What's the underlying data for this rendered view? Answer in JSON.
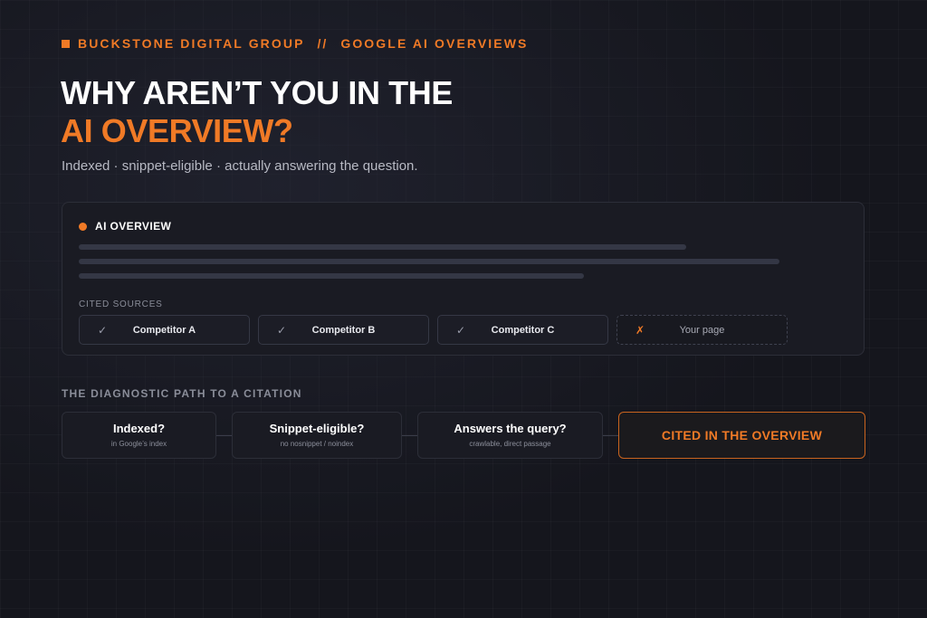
{
  "eyebrow": {
    "brand": "BUCKSTONE DIGITAL GROUP",
    "separator": "//",
    "topic": "GOOGLE AI OVERVIEWS"
  },
  "headline": {
    "line1": "WHY AREN’T YOU IN THE",
    "line2": "AI OVERVIEW?"
  },
  "subtitle": "Indexed · snippet-eligible · actually answering the question.",
  "overview": {
    "label": "AI OVERVIEW",
    "cited_label": "CITED SOURCES",
    "sources": [
      {
        "mark": "✓",
        "name": "Competitor A",
        "cited": true
      },
      {
        "mark": "✓",
        "name": "Competitor B",
        "cited": true
      },
      {
        "mark": "✓",
        "name": "Competitor C",
        "cited": true
      },
      {
        "mark": "✗",
        "name": "Your page",
        "cited": false
      }
    ]
  },
  "diagnostic": {
    "label": "THE DIAGNOSTIC PATH TO A CITATION",
    "steps": [
      {
        "title": "Indexed?",
        "sub": "in Google’s index"
      },
      {
        "title": "Snippet-eligible?",
        "sub": "no nosnippet / noindex"
      },
      {
        "title": "Answers the query?",
        "sub": "crawlable, direct passage"
      }
    ],
    "final": "CITED IN THE OVERVIEW"
  },
  "colors": {
    "accent": "#f07a26",
    "background": "#15161d",
    "card": "#1a1b23"
  }
}
